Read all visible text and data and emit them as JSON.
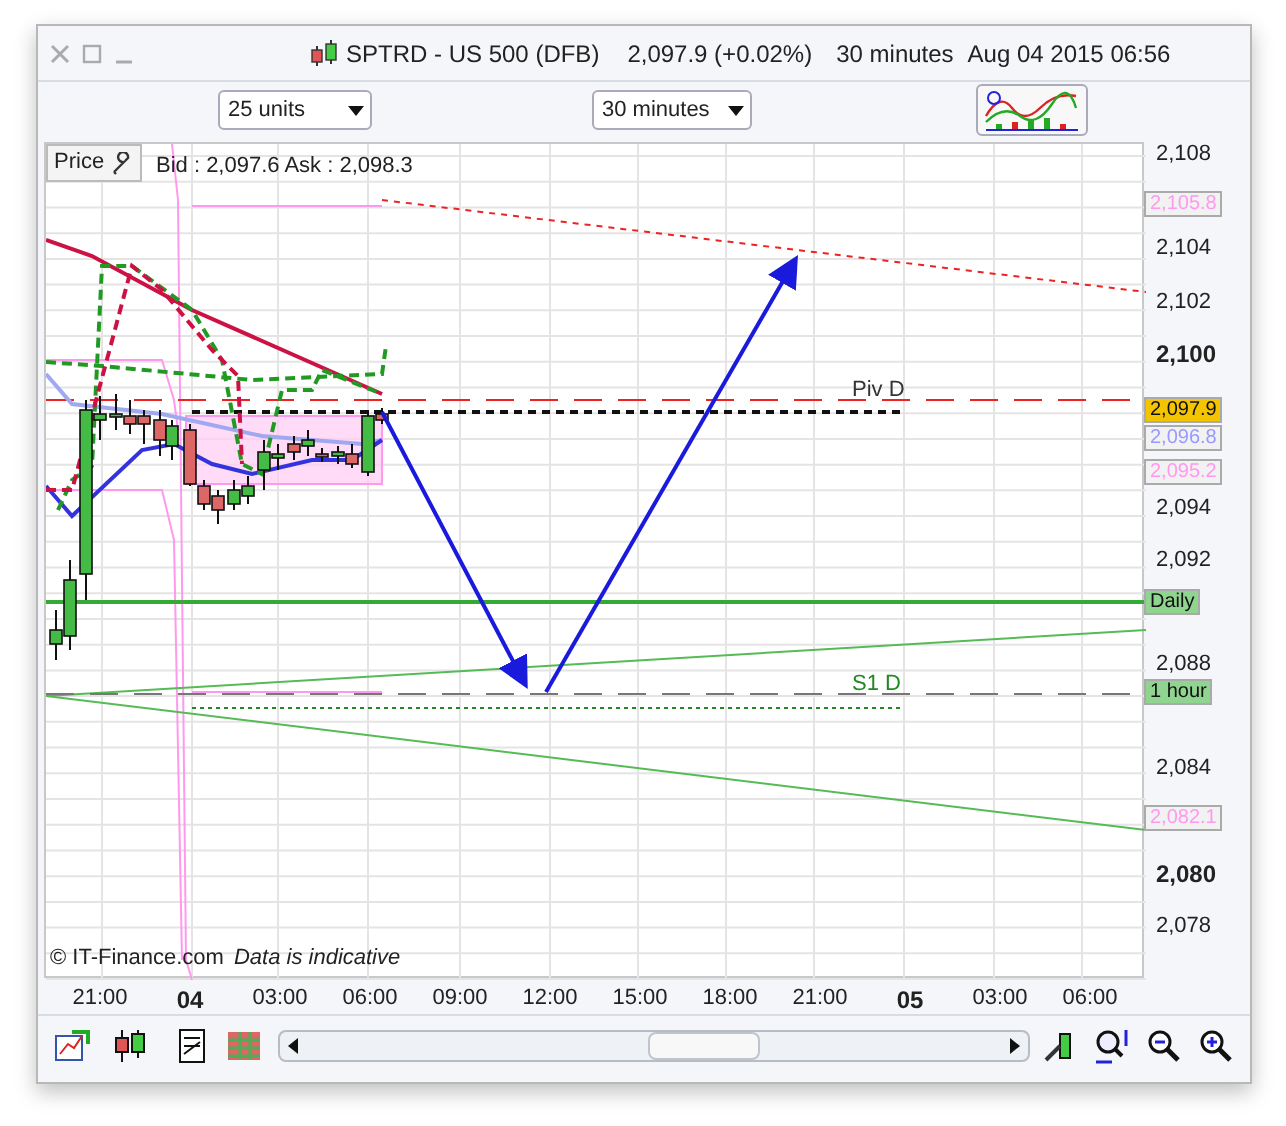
{
  "window": {
    "title": "SPTRD - US 500 (DFB)",
    "price": "2,097.9 (+0.02%)",
    "interval": "30 minutes",
    "datetime": "Aug 04 2015 06:56"
  },
  "toolbar": {
    "units_dropdown": "25 units",
    "interval_dropdown": "30 minutes"
  },
  "chart": {
    "price_button": "Price",
    "quote": "Bid : 2,097.6 Ask : 2,098.3",
    "credit": "© IT-Finance.com",
    "disclaimer": "Data is indicative",
    "level_labels": [
      {
        "text": "Piv D",
        "color": "#333333"
      },
      {
        "text": "S1 D",
        "color": "#228822"
      }
    ],
    "price_axis": [
      {
        "label": "2,108",
        "bold": false
      },
      {
        "label": "2,104",
        "bold": false
      },
      {
        "label": "2,102",
        "bold": false
      },
      {
        "label": "2,100",
        "bold": true
      },
      {
        "label": "2,094",
        "bold": false
      },
      {
        "label": "2,092",
        "bold": false
      },
      {
        "label": "2,088",
        "bold": false
      },
      {
        "label": "2,084",
        "bold": false
      },
      {
        "label": "2,080",
        "bold": true
      },
      {
        "label": "2,078",
        "bold": false
      }
    ],
    "price_tags": [
      {
        "text": "2,105.8",
        "kind": "band"
      },
      {
        "text": "2,097.9",
        "kind": "last"
      },
      {
        "text": "2,096.8",
        "kind": "average"
      },
      {
        "text": "2,095.2",
        "kind": "band"
      },
      {
        "text": "Daily",
        "kind": "timeframe"
      },
      {
        "text": "1 hour",
        "kind": "timeframe"
      },
      {
        "text": "2,082.1",
        "kind": "band"
      }
    ],
    "time_axis": [
      {
        "label": "21:00",
        "bold": false
      },
      {
        "label": "04",
        "bold": true
      },
      {
        "label": "03:00",
        "bold": false
      },
      {
        "label": "06:00",
        "bold": false
      },
      {
        "label": "09:00",
        "bold": false
      },
      {
        "label": "12:00",
        "bold": false
      },
      {
        "label": "15:00",
        "bold": false
      },
      {
        "label": "18:00",
        "bold": false
      },
      {
        "label": "21:00",
        "bold": false
      },
      {
        "label": "05",
        "bold": true
      },
      {
        "label": "03:00",
        "bold": false
      },
      {
        "label": "06:00",
        "bold": false
      }
    ]
  }
}
